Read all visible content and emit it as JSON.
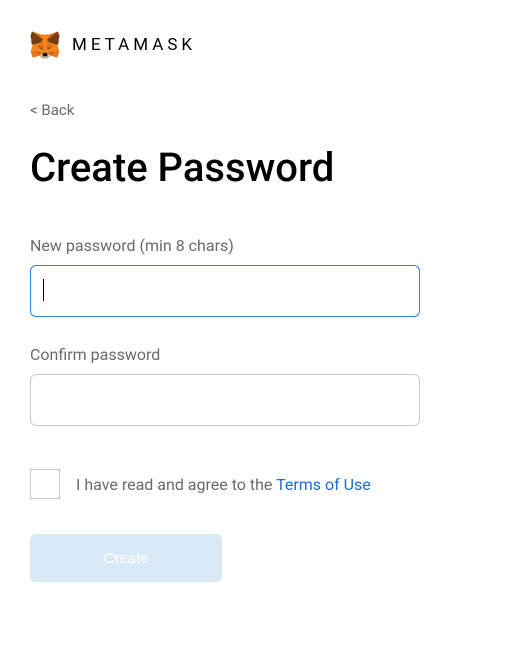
{
  "header": {
    "brand": "METAMASK"
  },
  "nav": {
    "back": "< Back"
  },
  "title": "Create Password",
  "fields": {
    "new_password_label": "New password (min 8 chars)",
    "new_password_value": "",
    "confirm_password_label": "Confirm password",
    "confirm_password_value": ""
  },
  "terms": {
    "text": "I have read and agree to the ",
    "link": "Terms of Use"
  },
  "button": {
    "create": "Create"
  }
}
